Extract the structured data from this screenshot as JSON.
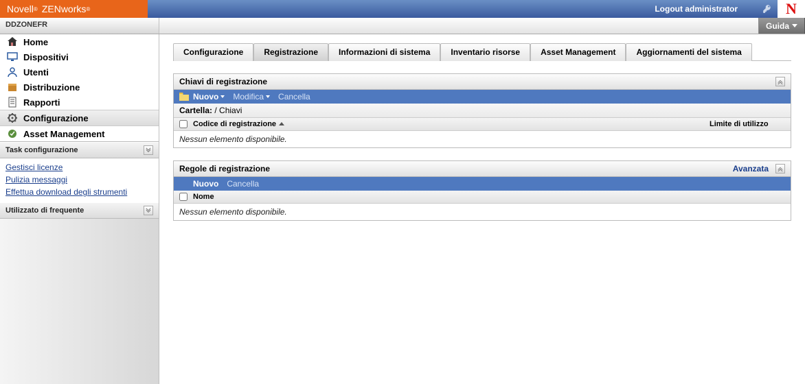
{
  "brand": {
    "name1": "Novell",
    "name2": "ZENworks"
  },
  "logout": "Logout administrator",
  "zone": "DDZONEFR",
  "guide": "Guida",
  "nav": [
    {
      "id": "home",
      "label": "Home"
    },
    {
      "id": "devices",
      "label": "Dispositivi"
    },
    {
      "id": "users",
      "label": "Utenti"
    },
    {
      "id": "distribution",
      "label": "Distribuzione"
    },
    {
      "id": "reports",
      "label": "Rapporti"
    },
    {
      "id": "config",
      "label": "Configurazione"
    },
    {
      "id": "asset",
      "label": "Asset Management"
    }
  ],
  "task_header": "Task configurazione",
  "tasks": {
    "t0": "Gestisci licenze",
    "t1": "Pulizia messaggi",
    "t2": "Effettua download degli strumenti"
  },
  "freq_header": "Utilizzato di frequente",
  "tabs": {
    "t0": "Configurazione",
    "t1": "Registrazione",
    "t2": "Informazioni di sistema",
    "t3": "Inventario risorse",
    "t4": "Asset Management",
    "t5": "Aggiornamenti del sistema"
  },
  "panel1": {
    "title": "Chiavi di registrazione",
    "new": "Nuovo",
    "edit": "Modifica",
    "delete": "Cancella",
    "folder_label": "Cartella:",
    "folder_path": "/ Chiavi",
    "col1": "Codice di registrazione",
    "col2": "Limite di utilizzo",
    "empty": "Nessun elemento disponibile."
  },
  "panel2": {
    "title": "Regole di registrazione",
    "advanced": "Avanzata",
    "new": "Nuovo",
    "delete": "Cancella",
    "col1": "Nome",
    "empty": "Nessun elemento disponibile."
  }
}
